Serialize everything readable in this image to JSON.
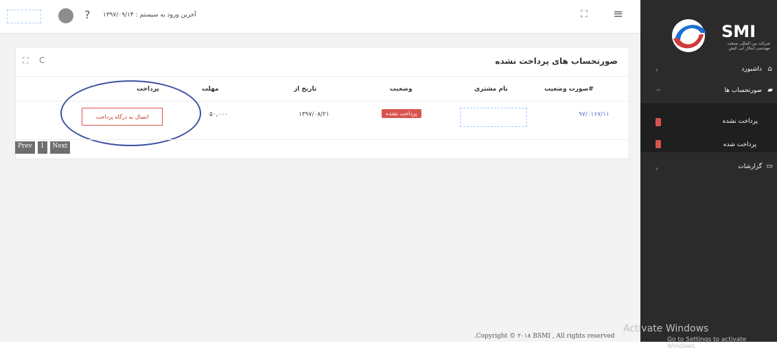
{
  "header": {
    "last_login_label": "آخرین ورود به سیستم : ۱۳۹۷/۰۹/۱۴",
    "help_symbol": "?",
    "fullscreen_symbol": "⛶",
    "menu_symbol": "≡"
  },
  "brand": {
    "name": "SMI",
    "subtitle": "شرکت بین المللی صنعت مهندسی ابتکار آبی کیش"
  },
  "sidebar": {
    "items": [
      {
        "label": "داشبورد",
        "chevron": "›"
      },
      {
        "label": "صورتحساب ها",
        "chevron": "^"
      },
      {
        "label": "پرداخت نشده"
      },
      {
        "label": "پرداخت شده"
      },
      {
        "label": "گزارشات",
        "chevron": "›"
      }
    ]
  },
  "card": {
    "title": "صورتحساب های پرداخت نشده",
    "tool_expand": "⛶",
    "tool_refresh": "C"
  },
  "table": {
    "headers": [
      "صورت وضعیت#",
      "نام مشتری",
      "وضعیت",
      "تاریخ از",
      "مهلت",
      "پرداخت"
    ],
    "rows": [
      {
        "invoice": "۹۷/۰۱۶۷/۱۱",
        "status": "پرداخت نشده",
        "date_from": "۱۳۹۷/۰۸/۲۱",
        "deadline": "۵۰,۰۰۰",
        "pay_label": "اتصال به درگاه پرداخت"
      }
    ]
  },
  "pagination": {
    "prev": "Prev",
    "page": "1",
    "next": "Next"
  },
  "footer": {
    "copyright": ".Copyright © ۲۰۱۸ BSMI , All rights reserved"
  },
  "watermark": {
    "line1": "Activate Windows",
    "line2": "Go to Settings to activate Windows."
  },
  "colors": {
    "sidebar_bg": "#2b2b2b",
    "badge_red": "#d9534f",
    "annotation_circle": "#3d4fa0"
  },
  "icons": [
    "help-icon",
    "fullscreen-icon",
    "hamburger-icon",
    "refresh-icon",
    "expand-icon",
    "home-icon",
    "invoice-icon",
    "report-icon"
  ]
}
